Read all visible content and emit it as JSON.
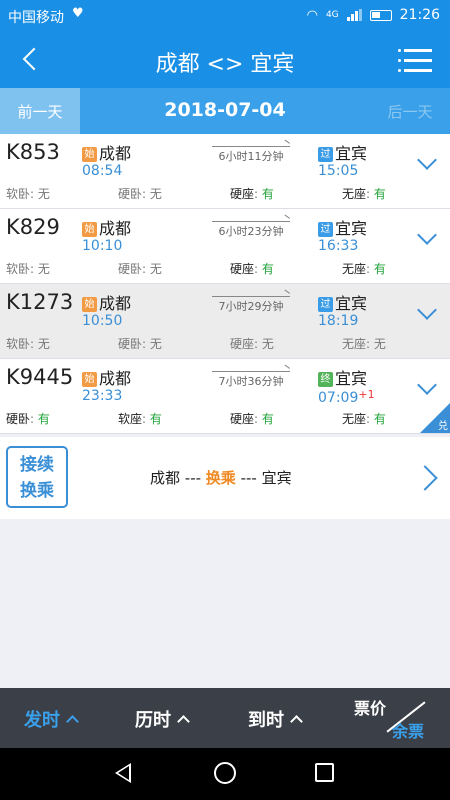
{
  "status_bar": {
    "carrier": "中国移动",
    "time": "21:26",
    "network": "4G"
  },
  "header": {
    "title": "成都 <> 宜宾"
  },
  "date_bar": {
    "prev_label": "前一天",
    "date": "2018-07-04",
    "next_label": "后一天"
  },
  "trains": [
    {
      "number": "K853",
      "from_badge": "始",
      "from_station": "成都",
      "depart": "08:54",
      "duration": "6小时11分钟",
      "to_badge": "过",
      "to_station": "宜宾",
      "arrive": "15:05",
      "arrive_plus": "",
      "seats": [
        {
          "label": "软卧",
          "value": "无"
        },
        {
          "label": "硬卧",
          "value": "无"
        },
        {
          "label": "硬座",
          "value": "有"
        },
        {
          "label": "无座",
          "value": "有"
        }
      ]
    },
    {
      "number": "K829",
      "from_badge": "始",
      "from_station": "成都",
      "depart": "10:10",
      "duration": "6小时23分钟",
      "to_badge": "过",
      "to_station": "宜宾",
      "arrive": "16:33",
      "arrive_plus": "",
      "seats": [
        {
          "label": "软卧",
          "value": "无"
        },
        {
          "label": "硬卧",
          "value": "无"
        },
        {
          "label": "硬座",
          "value": "有"
        },
        {
          "label": "无座",
          "value": "有"
        }
      ]
    },
    {
      "number": "K1273",
      "from_badge": "始",
      "from_station": "成都",
      "depart": "10:50",
      "duration": "7小时29分钟",
      "to_badge": "过",
      "to_station": "宜宾",
      "arrive": "18:19",
      "arrive_plus": "",
      "seats": [
        {
          "label": "软卧",
          "value": "无"
        },
        {
          "label": "硬卧",
          "value": "无"
        },
        {
          "label": "硬座",
          "value": "无"
        },
        {
          "label": "无座",
          "value": "无"
        }
      ]
    },
    {
      "number": "K9445",
      "from_badge": "始",
      "from_station": "成都",
      "depart": "23:33",
      "duration": "7小时36分钟",
      "to_badge": "终",
      "to_station": "宜宾",
      "arrive": "07:09",
      "arrive_plus": "+1",
      "seats": [
        {
          "label": "硬卧",
          "value": "有"
        },
        {
          "label": "软座",
          "value": "有"
        },
        {
          "label": "硬座",
          "value": "有"
        },
        {
          "label": "无座",
          "value": "有"
        }
      ],
      "corner_label": "兑"
    }
  ],
  "transfer": {
    "button_line1": "接续",
    "button_line2": "换乘",
    "from": "成都",
    "sep1": " --- ",
    "middle": "换乘",
    "sep2": " --- ",
    "to": "宜宾"
  },
  "sort_bar": {
    "depart_label": "发时",
    "duration_label": "历时",
    "arrive_label": "到时",
    "price_label": "票价",
    "remaining_label": "余票"
  },
  "colors": {
    "primary": "#1a8fe6",
    "accent_orange": "#f08a24",
    "available_green": "#22a33a"
  }
}
